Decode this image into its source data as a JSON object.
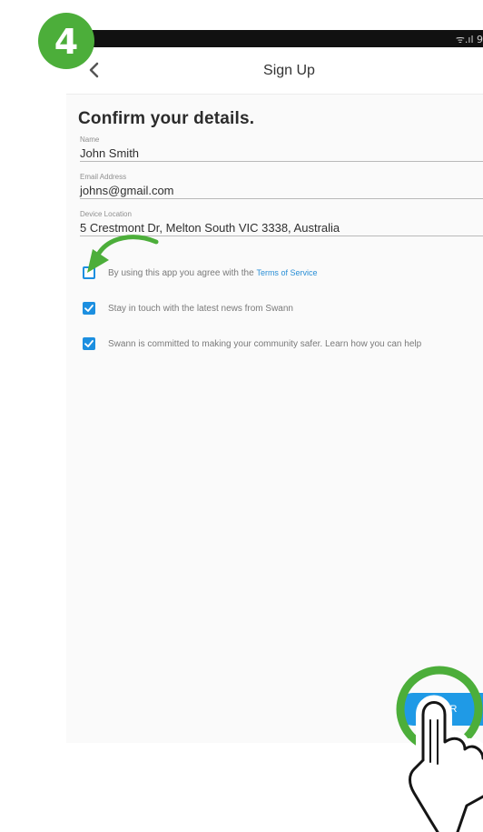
{
  "tutorial": {
    "step_number": "4"
  },
  "status_bar": {
    "icons_text": "ᯤ.ıl 9"
  },
  "header": {
    "title": "Sign Up"
  },
  "page": {
    "heading": "Confirm your details."
  },
  "fields": [
    {
      "label": "Name",
      "value": "John Smith"
    },
    {
      "label": "Email Address",
      "value": "johns@gmail.com"
    },
    {
      "label": "Device Location",
      "value": "5 Crestmont Dr, Melton South VIC 3338, Australia"
    }
  ],
  "checkboxes": [
    {
      "text": "By using this app you agree with the",
      "link": "Terms of Service",
      "checked": false
    },
    {
      "text": "Stay in touch with the latest news from Swann",
      "checked": true
    },
    {
      "text": "Swann is committed to making your community safer. Learn how you can help",
      "checked": true
    }
  ],
  "continue_button": {
    "label": "R"
  },
  "colors": {
    "accent": "#1c8fe0",
    "tutorial_green": "#4cae3a",
    "status_bar": "#111111"
  }
}
